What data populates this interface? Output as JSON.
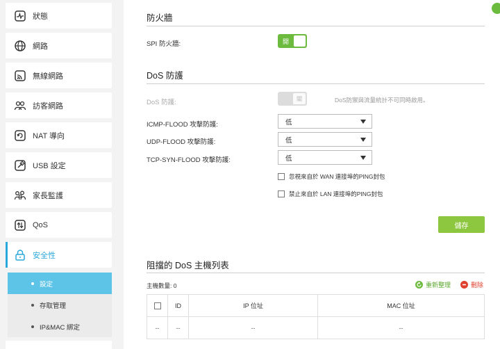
{
  "sidebar": {
    "items": [
      {
        "label": "狀態",
        "icon": "status-icon"
      },
      {
        "label": "網路",
        "icon": "globe-icon"
      },
      {
        "label": "無線網路",
        "icon": "wireless-icon"
      },
      {
        "label": "訪客網路",
        "icon": "guest-icon"
      },
      {
        "label": "NAT 導向",
        "icon": "nat-icon"
      },
      {
        "label": "USB 設定",
        "icon": "usb-icon"
      },
      {
        "label": "家長監護",
        "icon": "parental-icon"
      },
      {
        "label": "QoS",
        "icon": "qos-icon"
      },
      {
        "label": "安全性",
        "icon": "lock-icon"
      }
    ],
    "submenu": [
      {
        "label": "設定"
      },
      {
        "label": "存取管理"
      },
      {
        "label": "IP&MAC 綁定"
      }
    ]
  },
  "firewall": {
    "title": "防火牆",
    "spi_label": "SPI 防火牆:",
    "spi_toggle_text": "開"
  },
  "dos": {
    "title": "DoS 防護",
    "dos_label": "DoS 防護:",
    "dos_toggle_text": "關",
    "hint": "DoS防禦與流量統計不可同時啟用。",
    "icmp_label": "ICMP-FLOOD 攻擊防護:",
    "icmp_value": "低",
    "udp_label": "UDP-FLOOD 攻擊防護:",
    "udp_value": "低",
    "tcp_label": "TCP-SYN-FLOOD 攻擊防護:",
    "tcp_value": "低",
    "wan_ping_label": "忽視來自於 WAN 連接埠的PING封包",
    "lan_ping_label": "禁止來自於 LAN 連接埠的PING封包",
    "save_label": "儲存"
  },
  "blocked": {
    "title": "阻擋的 DoS 主機列表",
    "count_label": "主機數量: 0",
    "refresh_label": "重新整理",
    "delete_label": "刪除",
    "columns": [
      "ID",
      "IP 位址",
      "MAC 位址"
    ],
    "row": [
      "--",
      "--",
      "--",
      "--"
    ]
  },
  "colors": {
    "accent": "#2aa8dc",
    "green": "#6dbb3e",
    "delete": "#e0412f"
  }
}
